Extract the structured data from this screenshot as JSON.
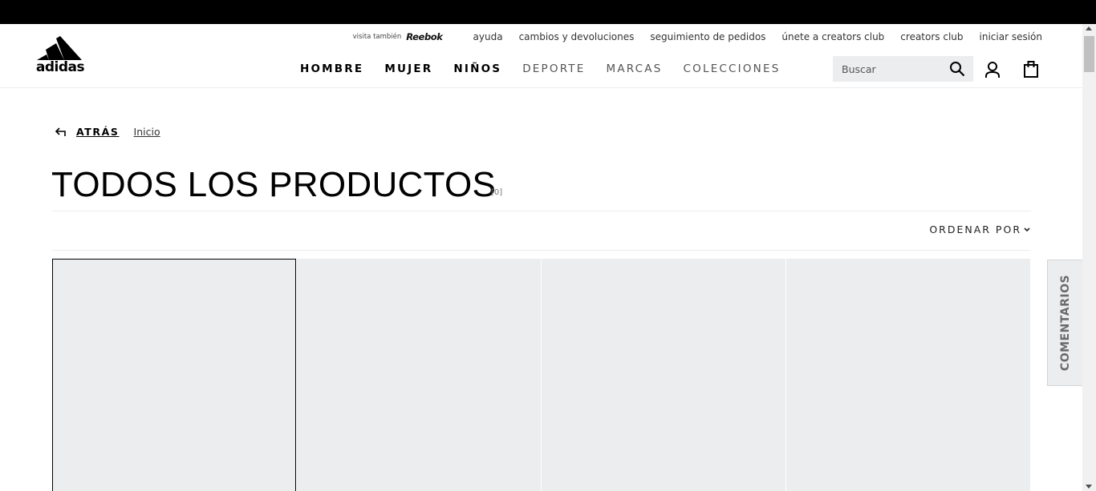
{
  "brand": {
    "logo_text": "adidas",
    "partner_prefix": "visita también",
    "partner_name": "Reebok"
  },
  "utility_nav": [
    {
      "label": "ayuda"
    },
    {
      "label": "cambios y devoluciones"
    },
    {
      "label": "seguimiento de pedidos"
    },
    {
      "label": "únete a creators club"
    },
    {
      "label": "creators club"
    },
    {
      "label": "iniciar sesión"
    }
  ],
  "main_nav": [
    {
      "label": "HOMBRE",
      "weight": "bold"
    },
    {
      "label": "MUJER",
      "weight": "bold"
    },
    {
      "label": "NIÑOS",
      "weight": "bold"
    },
    {
      "label": "DEPORTE",
      "weight": "light"
    },
    {
      "label": "MARCAS",
      "weight": "light"
    },
    {
      "label": "COLECCIONES",
      "weight": "light"
    }
  ],
  "search": {
    "placeholder": "Buscar",
    "value": ""
  },
  "icons": {
    "search": "search-icon",
    "account": "account-icon",
    "bag": "shopping-bag-icon",
    "back": "back-arrow-icon",
    "sort": "chevron-down-icon"
  },
  "breadcrumb": {
    "back_label": "ATRÁS",
    "home_label": "Inicio"
  },
  "page": {
    "title": "TODOS LOS PRODUCTOS",
    "count": "[0]"
  },
  "sort": {
    "label": "ORDENAR POR"
  },
  "products": [
    {
      "state": "placeholder"
    },
    {
      "state": "placeholder"
    },
    {
      "state": "placeholder"
    },
    {
      "state": "placeholder"
    }
  ],
  "feedback": {
    "label": "COMENTARIOS"
  },
  "colors": {
    "top_bar": "#000000",
    "card_background": "#ebedee",
    "text": "#000000",
    "muted": "#767677"
  }
}
